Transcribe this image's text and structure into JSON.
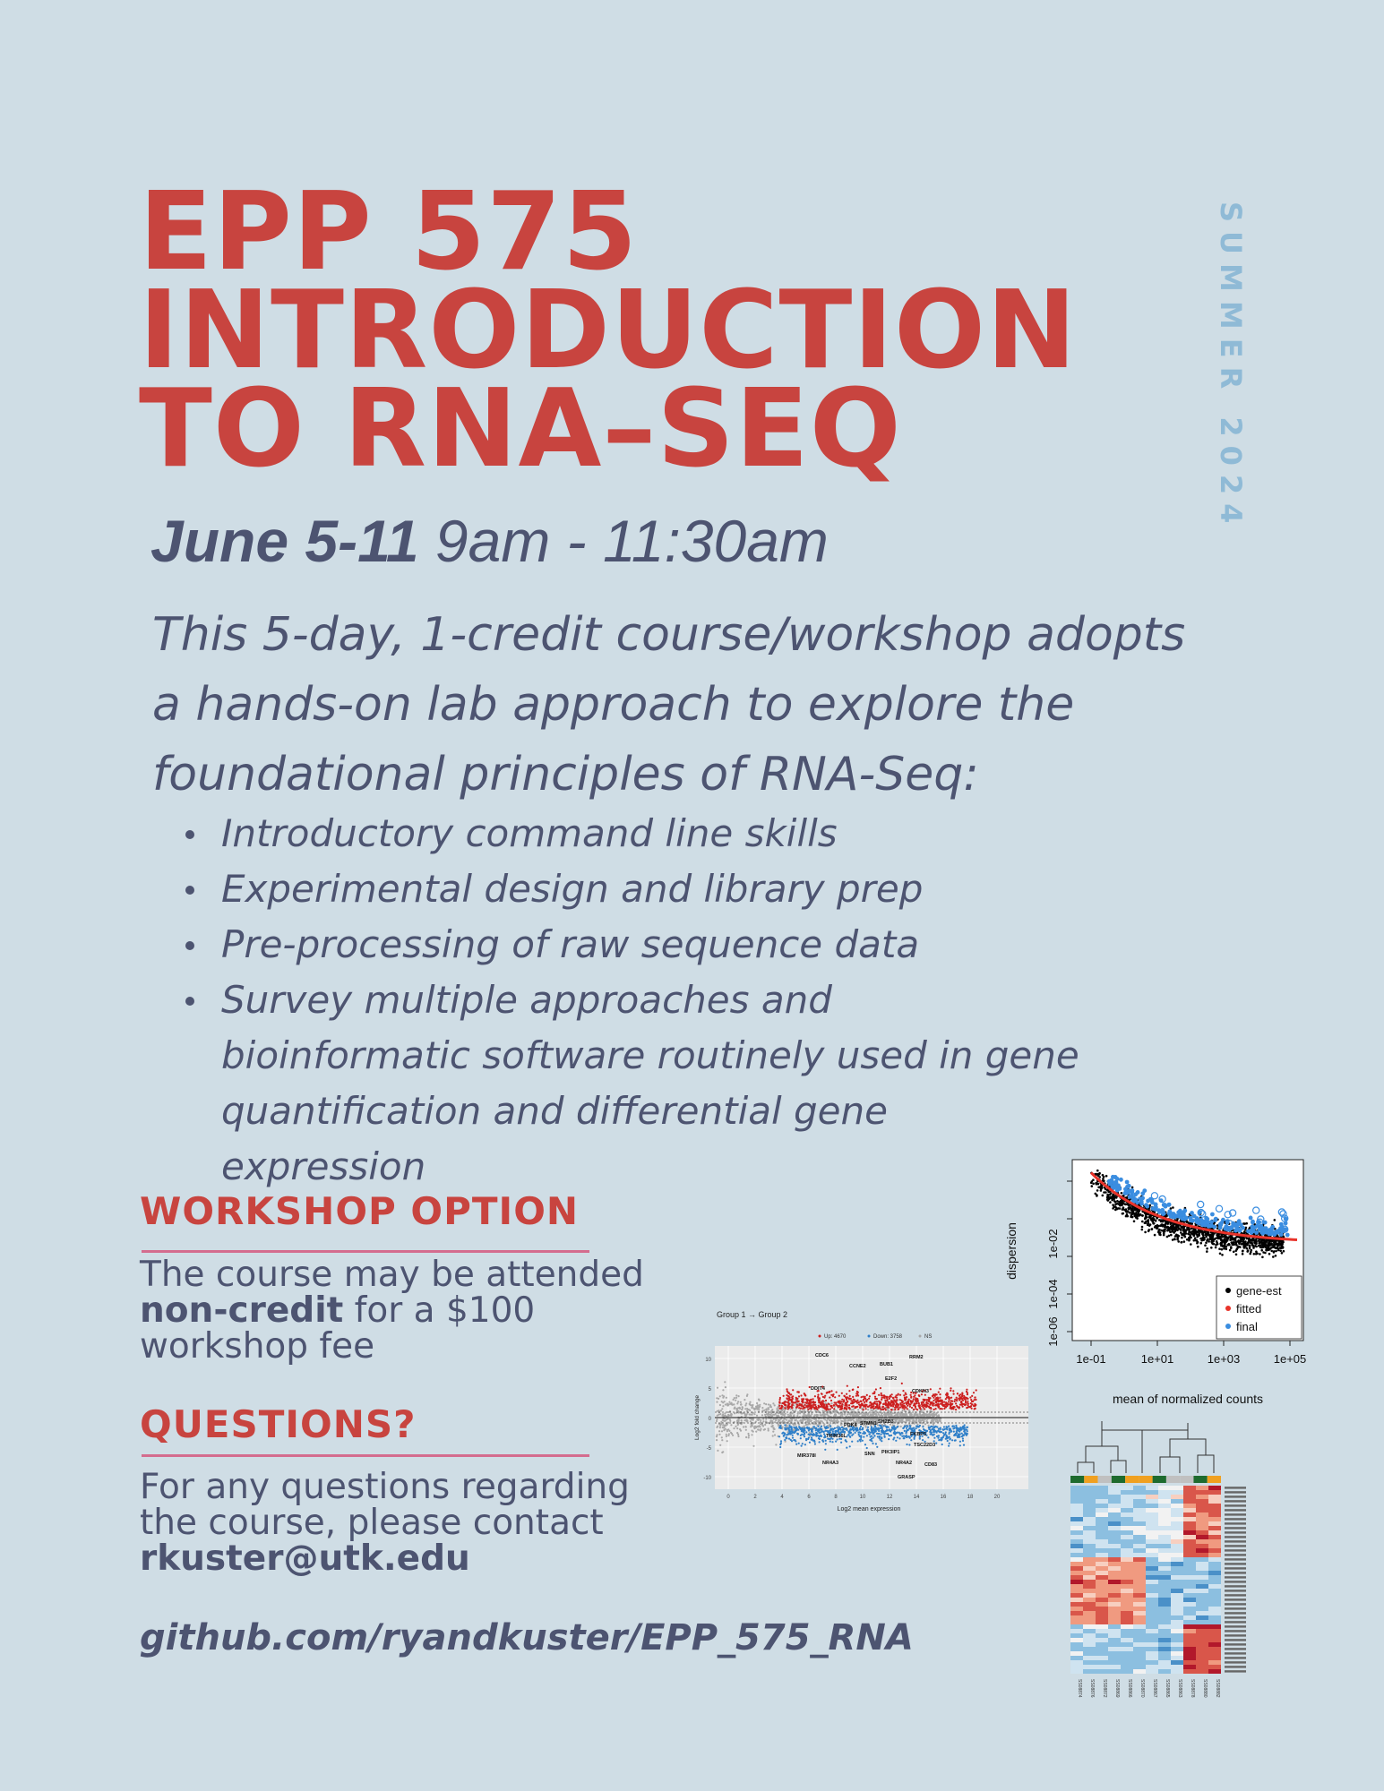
{
  "header": {
    "title_lines": [
      "EPP 575",
      "INTRODUCTION",
      "TO RNA–SEQ"
    ],
    "season": "SUMMER 2024"
  },
  "schedule": {
    "dates": "June 5-11",
    "time": " 9am - 11:30am"
  },
  "description": {
    "intro": "This 5-day, 1-credit course/workshop adopts a  hands-on lab approach to explore the foundational principles of RNA-Seq:",
    "topics": [
      "Introductory command line skills",
      "Experimental design and library prep",
      "Pre-processing of raw sequence data",
      "Survey multiple approaches and bioinformatic software routinely used in gene quantification and differential gene expression"
    ]
  },
  "workshop": {
    "heading": "WORKSHOP OPTION",
    "text_before": "The course may be attended ",
    "text_bold": "non-credit",
    "text_after": " for a $100 workshop fee"
  },
  "questions": {
    "heading": "QUESTIONS?",
    "text": "For any questions regarding the course, please contact ",
    "email": "rkuster@utk.edu"
  },
  "repo": "github.com/ryandkuster/EPP_575_RNA",
  "figures": {
    "ma_plot": {
      "title": "Group 1 → Group 2",
      "legend": [
        "Up: 4670",
        "Down: 3758",
        "NS"
      ],
      "xlabel": "Log2 mean expression",
      "ylabel": "Log2 fold change",
      "x_ticks": [
        "0",
        "2",
        "4",
        "6",
        "8",
        "10",
        "12",
        "14",
        "16",
        "18",
        "20"
      ],
      "y_ticks": [
        "10",
        "5",
        "0",
        "-5",
        "-10"
      ],
      "gene_labels": [
        "CDC6",
        "RRM2",
        "CCNE2",
        "BUB1",
        "E2F2",
        "CDKN3",
        "DDIT4",
        "SH2B3",
        "PDK4",
        "TRIM16L",
        "FKBP5",
        "CD83",
        "SNN",
        "PIK3IP1",
        "TSC22D3",
        "NR4A3",
        "MIR378I",
        "NR4A2",
        "GRASP",
        "STMN1"
      ],
      "colors": {
        "up": "#cc1f1f",
        "down": "#2f7fc8",
        "ns": "#a8a8a8"
      }
    },
    "dispersion_plot": {
      "xlabel": "mean of normalized counts",
      "ylabel": "dispersion",
      "x_ticks": [
        "1e-01",
        "1e+01",
        "1e+03",
        "1e+05"
      ],
      "y_ticks": [
        "1e-06",
        "1e-04",
        "1e-02"
      ],
      "legend": [
        {
          "label": "gene-est",
          "color": "#000000"
        },
        {
          "label": "fitted",
          "color": "#e8332a"
        },
        {
          "label": "final",
          "color": "#3a8de0"
        }
      ]
    },
    "heatmap": {
      "group_colors": [
        "#1e6b2e",
        "#f0a020",
        "#c0c0c0",
        "#1e6b2e",
        "#f0a020",
        "#f0a020",
        "#1e6b2e",
        "#c0c0c0",
        "#c0c0c0",
        "#1e6b2e",
        "#f0a020"
      ],
      "sample_labels": [
        "SS08874",
        "SS08876",
        "SS08872",
        "SS08869",
        "SS08866",
        "SS08870",
        "SS08867",
        "SS08865",
        "SS08863",
        "SS08878",
        "SS08880",
        "SS08882"
      ]
    }
  }
}
